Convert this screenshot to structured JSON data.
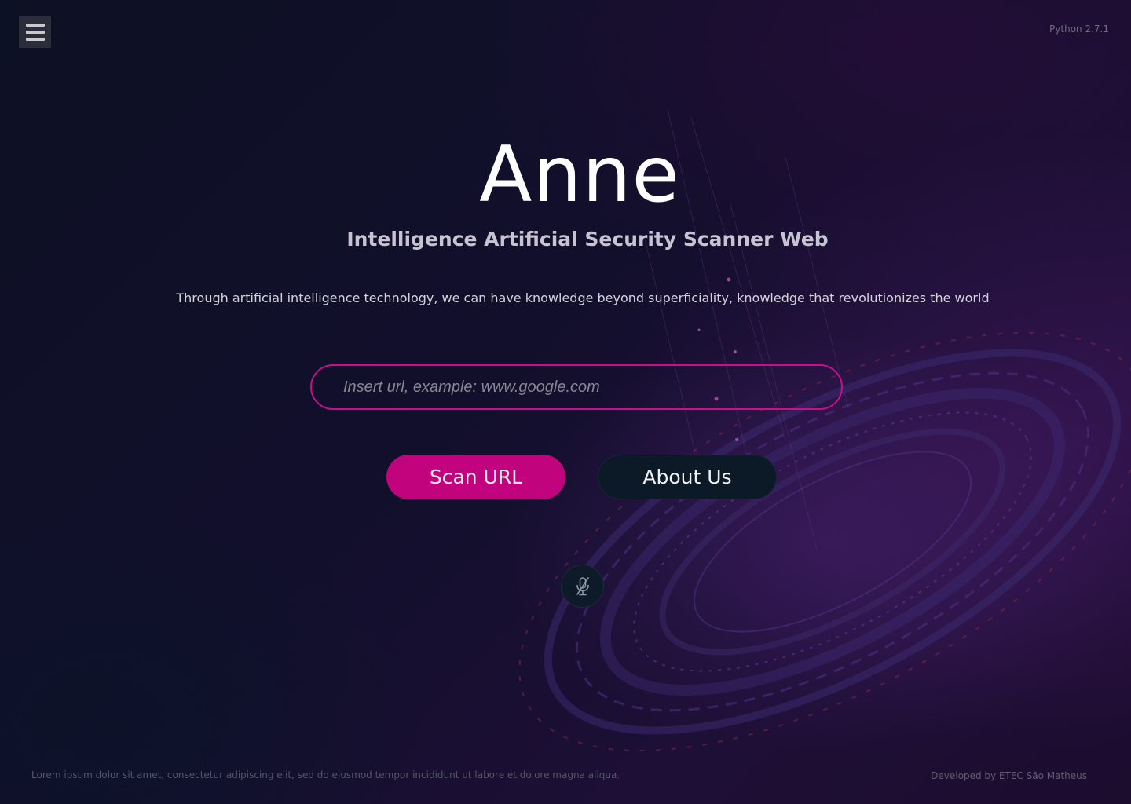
{
  "header": {
    "menu_icon": "hamburger-menu-icon",
    "version": "Python 2.7.1"
  },
  "hero": {
    "title": "Anne",
    "subtitle": "Intelligence Artificial Security Scanner Web",
    "description": "Through artificial intelligence technology, we can have knowledge beyond superficiality, knowledge that revolutionizes the world"
  },
  "search": {
    "value": "",
    "placeholder": "Insert url, example: www.google.com"
  },
  "actions": {
    "scan_label": "Scan URL",
    "about_label": "About Us"
  },
  "voice": {
    "icon": "microphone-muted-icon"
  },
  "footer": {
    "lorem": "Lorem ipsum dolor sit amet, consectetur adipiscing elit, sed do eiusmod tempor incididunt ut labore et dolore magna aliqua.",
    "credit": "Developed by ETEC São Matheus"
  },
  "colors": {
    "accent": "#c1047e",
    "input_border": "#c8108a",
    "background": "#0e1027",
    "secondary_button": "#0c1a28"
  }
}
